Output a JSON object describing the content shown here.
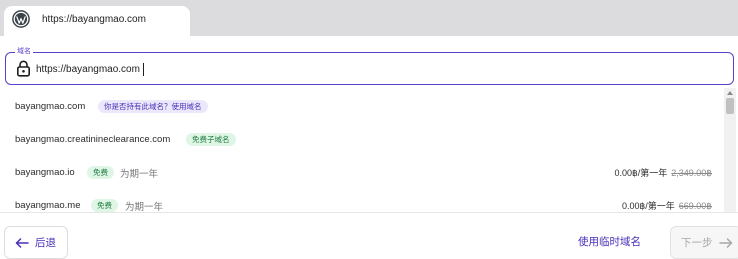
{
  "tab": {
    "icon": "wordpress-icon",
    "title": "https://bayangmao.com"
  },
  "field": {
    "label": "域名",
    "value": "https://bayangmao.com",
    "icon": "lock-icon"
  },
  "results": [
    {
      "domain": "bayangmao.com",
      "badge": "你是否持有此域名？使用域名",
      "badge_color": "purple"
    },
    {
      "domain": "bayangmao.creatinineclearance.com",
      "badge": "免费子域名",
      "badge_color": "green"
    },
    {
      "domain": "bayangmao.io",
      "badge": "免费",
      "badge_color": "green",
      "term": "为期一年",
      "price": "0.00฿/第一年",
      "old_price": "2,349.00฿"
    },
    {
      "domain": "bayangmao.me",
      "badge": "免费",
      "badge_color": "green",
      "term": "为期一年",
      "price": "0.00฿/第一年",
      "old_price": "669.00฿"
    }
  ],
  "footer": {
    "back_label": "后退",
    "temp_domain_label": "使用临时域名",
    "next_label": "下一步"
  },
  "colors": {
    "accent": "#5a3fc8",
    "link": "#4a2fb8",
    "badge_purple_bg": "#ece8fb",
    "badge_green_bg": "#dff5e6"
  }
}
